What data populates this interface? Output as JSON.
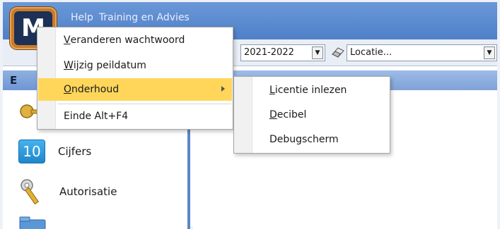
{
  "titlebar": {
    "menu_help": "Help",
    "menu_training": "Training en Advies"
  },
  "logo": {
    "letter": "M",
    "bg_color": "#cc7a28"
  },
  "toolbar": {
    "year_combo": "2021-2022",
    "location_combo": "Locatie...",
    "eraser_icon": "eraser-icon"
  },
  "leftnav": {
    "header": "E",
    "items": [
      {
        "icon": "keys-icon",
        "label": ""
      },
      {
        "icon": "grades-10-icon",
        "icon_text": "10",
        "label": "Cijfers"
      },
      {
        "icon": "key-icon",
        "label": "Autorisatie"
      },
      {
        "icon": "folder-icon",
        "label": ""
      }
    ]
  },
  "context_menu": {
    "items": [
      {
        "label_prefix": "",
        "label_underline": "V",
        "label_rest": "eranderen wachtwoord"
      },
      {
        "label_prefix": "",
        "label_underline": "W",
        "label_rest": "ijzig peildatum"
      },
      {
        "label_prefix": "",
        "label_underline": "O",
        "label_rest": "nderhoud",
        "highlighted": true,
        "has_submenu": true
      },
      {
        "label": "Einde Alt+F4"
      }
    ],
    "highlight_color": "#ffd65a"
  },
  "submenu": {
    "items": [
      {
        "label_underline": "L",
        "label_rest": "icentie inlezen"
      },
      {
        "label_underline": "D",
        "label_rest": "ecibel"
      },
      {
        "label": "Debugscherm"
      }
    ]
  }
}
